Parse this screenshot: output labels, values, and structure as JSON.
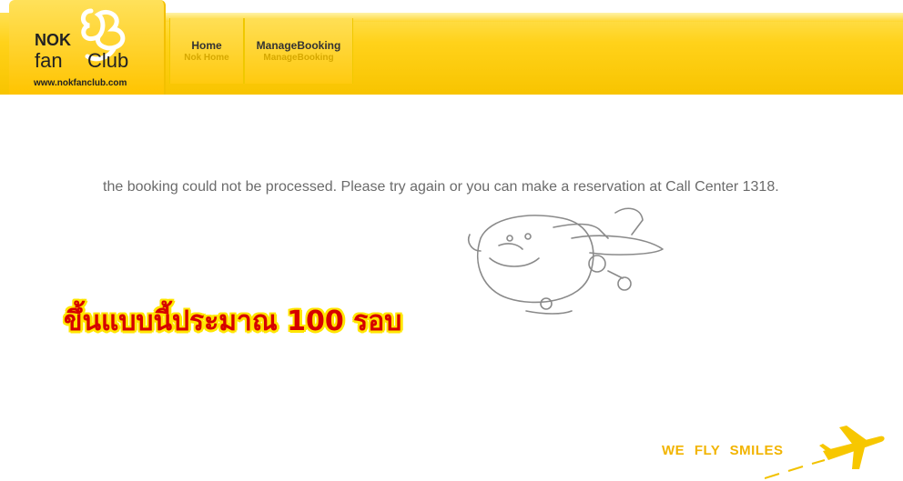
{
  "header": {
    "logo": {
      "line1": "NOK",
      "line2a": "fan",
      "line2b": "Club",
      "url": "www.nokfanclub.com"
    },
    "nav": [
      {
        "label": "Home",
        "sublabel": "Nok Home"
      },
      {
        "label": "ManageBooking",
        "sublabel": "ManageBooking"
      }
    ]
  },
  "main": {
    "error_message": "the booking could not be processed. Please try again or you can make a reservation at Call Center 1318.",
    "annotation": "ขึ้นแบบนี้ประมาณ 100 รอบ"
  },
  "footer": {
    "slogan": "WE FLY SMILES"
  },
  "icons": {
    "logo": "nok-bird-logo-icon",
    "mascot": "plane-mascot-sketch-icon",
    "footer_plane": "airplane-icon"
  },
  "colors": {
    "header_yellow": "#ffd21a",
    "message_gray": "#6b6b6b",
    "annotation_red": "#d60000",
    "annotation_outline": "#ffe600",
    "slogan_yellow": "#f2b400"
  }
}
